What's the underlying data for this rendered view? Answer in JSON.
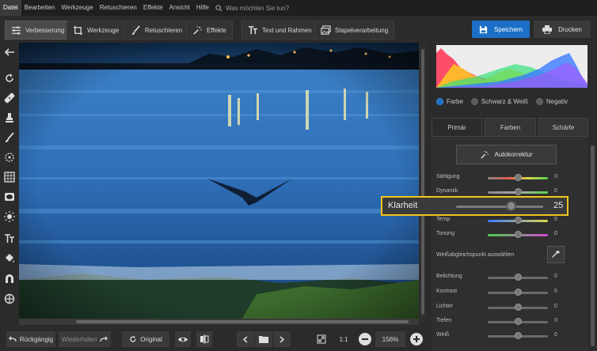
{
  "menu": {
    "items": [
      "Datei",
      "Bearbeiten",
      "Werkzeuge",
      "Retuschieren",
      "Effekte",
      "Ansicht",
      "Hilfe"
    ],
    "search_placeholder": "Was möchten Sie tun?"
  },
  "toolbar": {
    "tabs": [
      "Verbesserung",
      "Werkzeuge",
      "Retuschieren",
      "Effekte",
      "Text und Rahmen",
      "Stapelverarbeitung"
    ],
    "save_label": "Speichern",
    "print_label": "Drucken",
    "accent": "#1b6fc6"
  },
  "left_tools": [
    "back-arrow-icon",
    "rotate-icon",
    "healing-patch-icon",
    "stamp-icon",
    "brush-icon",
    "target-icon",
    "grid-icon",
    "vignette-icon",
    "sun-icon",
    "text-icon",
    "bucket-icon",
    "magnet-icon",
    "crosshair-icon"
  ],
  "bottom": {
    "undo_label": "Rückgängig",
    "redo_label": "Wiederholen",
    "original_label": "Original",
    "ratio_label": "1:1",
    "zoom_value": "156%"
  },
  "panel": {
    "modes": [
      "Farbe",
      "Schwarz & Weiß",
      "Negativ"
    ],
    "selected_mode": "Farbe",
    "tabs": [
      "Primär",
      "Farben",
      "Schärfe"
    ],
    "autocorrect_label": "Autokorrektur",
    "whitebalance_label": "Weißabgleichspunkt auswählen",
    "sliders": [
      {
        "label": "Sättigung",
        "value": "0"
      },
      {
        "label": "Dynamik",
        "value": "0"
      },
      {
        "label": "Temp",
        "value": "0"
      },
      {
        "label": "Tonung",
        "value": "0"
      },
      {
        "label": "Belichtung",
        "value": "0"
      },
      {
        "label": "Kontrast",
        "value": "0"
      },
      {
        "label": "Lichter",
        "value": "0"
      },
      {
        "label": "Tiefen",
        "value": "0"
      },
      {
        "label": "Weiß",
        "value": "0"
      }
    ],
    "highlight": {
      "label": "Klarheit",
      "value": "25",
      "color": "#f0c419"
    }
  }
}
